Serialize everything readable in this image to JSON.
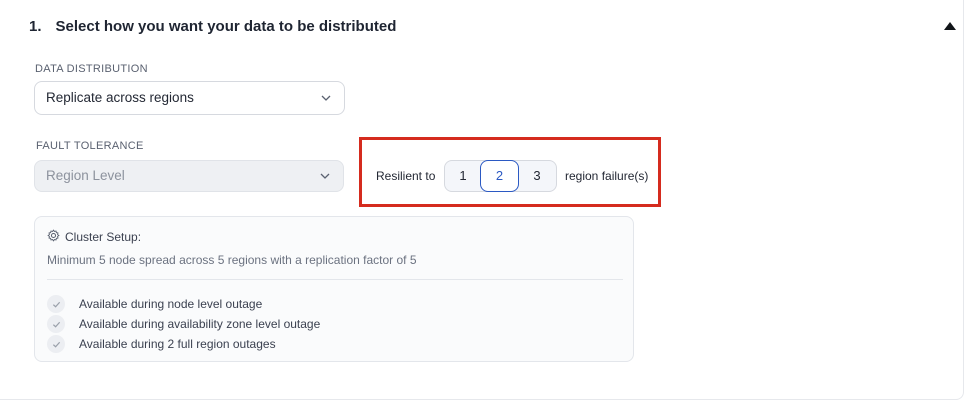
{
  "section": {
    "number": "1.",
    "title": "Select how you want your data to be distributed"
  },
  "data_distribution": {
    "label": "DATA DISTRIBUTION",
    "value": "Replicate across regions"
  },
  "fault_tolerance": {
    "label": "FAULT TOLERANCE",
    "value": "Region Level",
    "disabled": true
  },
  "resilience": {
    "prefix": "Resilient to",
    "options": [
      "1",
      "2",
      "3"
    ],
    "selected": "2",
    "suffix": "region failure(s)"
  },
  "cluster_setup": {
    "title": "Cluster Setup:",
    "description": "Minimum 5 node spread across 5 regions with a replication factor of 5",
    "features": [
      "Available during node level outage",
      "Available during availability zone level outage",
      "Available during 2 full region outages"
    ]
  },
  "colors": {
    "highlight": "#d52b1e",
    "selected_accent": "#2b59c3"
  }
}
